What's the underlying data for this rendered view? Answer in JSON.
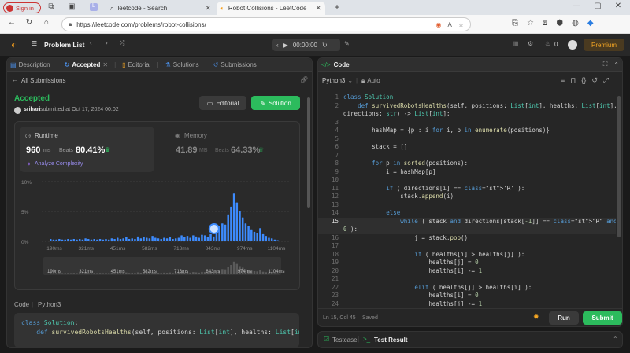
{
  "browser": {
    "profile_label": "Sign in",
    "tabs": [
      {
        "label": "leetcode - Search"
      },
      {
        "label": "Robot Collisions - LeetCode"
      }
    ],
    "url": "https://leetcode.com/problems/robot-collisions/"
  },
  "nav": {
    "title": "Problem List",
    "timer": "00:00:00",
    "streak": "0",
    "premium": "Premium"
  },
  "left": {
    "tabs": [
      "Description",
      "Accepted",
      "Editorial",
      "Solutions",
      "Submissions"
    ],
    "back_label": "All Submissions",
    "status": "Accepted",
    "user": "srihari",
    "submitted": "submitted at Oct 17, 2024 00:02",
    "editorial_btn": "Editorial",
    "solution_btn": "Solution",
    "runtime_label": "Runtime",
    "runtime_value": "960",
    "runtime_unit": "ms",
    "beats_label": "Beats",
    "runtime_beats": "80.41%",
    "analyze": "Analyze Complexity",
    "memory_label": "Memory",
    "memory_value": "41.89",
    "memory_unit": "MB",
    "memory_beats": "64.33%",
    "code_lang_label": "Code",
    "code_lang": "Python3",
    "preview_lines": [
      "class Solution:",
      "    def survivedRobotsHealths(self, positions: List[int], healths: List[int"
    ]
  },
  "chart_data": {
    "type": "bar",
    "yticks": [
      "10%",
      "5%",
      "0%"
    ],
    "xticks": [
      "190ms",
      "321ms",
      "451ms",
      "582ms",
      "713ms",
      "843ms",
      "974ms",
      "1104ms"
    ],
    "ylim": [
      0,
      10
    ],
    "values": [
      0.4,
      0.3,
      0.3,
      0.4,
      0.3,
      0.3,
      0.4,
      0.3,
      0.4,
      0.3,
      0.4,
      0.3,
      0.5,
      0.4,
      0.3,
      0.4,
      0.3,
      0.4,
      0.3,
      0.4,
      0.3,
      0.5,
      0.4,
      0.6,
      0.4,
      0.5,
      0.7,
      0.4,
      0.5,
      0.4,
      0.8,
      0.5,
      0.7,
      0.6,
      0.5,
      0.9,
      0.6,
      0.5,
      0.4,
      0.6,
      0.5,
      0.7,
      0.4,
      0.5,
      0.6,
      1.0,
      0.7,
      0.9,
      0.6,
      1.0,
      0.8,
      0.6,
      1.1,
      1.0,
      0.7,
      1.2,
      0.8,
      1.6,
      2.5,
      3.0,
      2.8,
      4.5,
      5.8,
      8.0,
      6.5,
      5.0,
      4.0,
      3.0,
      2.6,
      2.0,
      1.6,
      1.4,
      2.2,
      1.2,
      0.9,
      0.6,
      0.5,
      0.3,
      0.2
    ],
    "highlight_value": "960ms",
    "minimap_xticks": [
      "190ms",
      "321ms",
      "451ms",
      "582ms",
      "713ms",
      "843ms",
      "974ms",
      "1104ms"
    ]
  },
  "editor": {
    "title": "Code",
    "language": "Python3",
    "mode": "Auto",
    "lines": [
      {
        "n": "1",
        "t": "class Solution:"
      },
      {
        "n": "2",
        "t": "    def survivedRobotsHealths(self, positions: List[int], healths: List[int],"
      },
      {
        "n": "",
        "t": "directions: str) -> List[int]:"
      },
      {
        "n": "3",
        "t": ""
      },
      {
        "n": "4",
        "t": "        hashMap = {p : i for i, p in enumerate(positions)}"
      },
      {
        "n": "5",
        "t": ""
      },
      {
        "n": "6",
        "t": "        stack = []"
      },
      {
        "n": "7",
        "t": ""
      },
      {
        "n": "8",
        "t": "        for p in sorted(positions):"
      },
      {
        "n": "9",
        "t": "            i = hashMap[p]"
      },
      {
        "n": "10",
        "t": ""
      },
      {
        "n": "11",
        "t": "            if ( directions[i] == 'R' ):"
      },
      {
        "n": "12",
        "t": "                stack.append(i)"
      },
      {
        "n": "13",
        "t": ""
      },
      {
        "n": "14",
        "t": "            else:"
      },
      {
        "n": "15",
        "t": "                while ( stack and directions[stack[-1]] == \"R\" and healths[i] >"
      },
      {
        "n": "",
        "t": "0 ):"
      },
      {
        "n": "16",
        "t": "                    j = stack.pop()"
      },
      {
        "n": "17",
        "t": ""
      },
      {
        "n": "18",
        "t": "                    if ( healths[i] > healths[j] ):"
      },
      {
        "n": "19",
        "t": "                        healths[j] = 0"
      },
      {
        "n": "20",
        "t": "                        healths[i] -= 1"
      },
      {
        "n": "21",
        "t": ""
      },
      {
        "n": "22",
        "t": "                    elif ( healths[j] > healths[i] ):"
      },
      {
        "n": "23",
        "t": "                        healths[i] = 0"
      },
      {
        "n": "24",
        "t": "                        healths[j] -= 1"
      }
    ],
    "status": "Ln 15, Col 45",
    "saved": "Saved",
    "run": "Run",
    "submit": "Submit"
  },
  "bottom": {
    "testcase": "Testcase",
    "result": "Test Result"
  }
}
